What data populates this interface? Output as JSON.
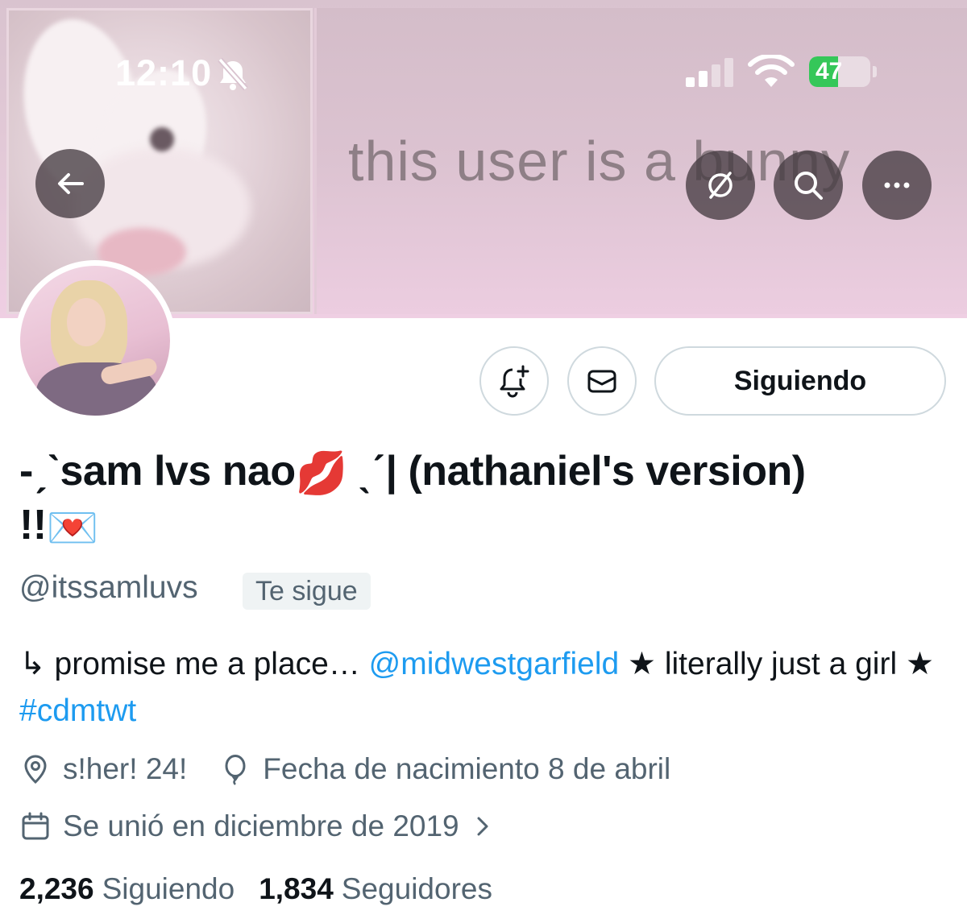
{
  "status_bar": {
    "time": "12:10",
    "battery_label": "47",
    "battery_level": 0.47,
    "battery_color": "#35c759"
  },
  "banner": {
    "text": "this user is a bunny"
  },
  "nav": {
    "back_icon": "arrow-left-icon",
    "grok_icon": "slash-circle-icon",
    "search_icon": "search-icon",
    "more_icon": "more-icon"
  },
  "actions": {
    "notify_icon": "bell-plus-icon",
    "message_icon": "envelope-icon",
    "follow_label": "Siguiendo"
  },
  "profile": {
    "name_part1": "-ˏˋsam lvs nao",
    "name_emoji1": "💋",
    "name_part2": "ˎˊ| (nathaniel's version) !!",
    "name_emoji2": "💌",
    "handle": "@itssamluvs",
    "follows_you": "Te sigue"
  },
  "bio": {
    "prefix": "↳ promise me a place… ",
    "mention": "@midwestgarfield",
    "middle": " ★ literally just a girl ★ ",
    "hashtag": "#cdmtwt"
  },
  "meta": {
    "location": "s!her! 24!",
    "birthday": "Fecha de nacimiento 8 de abril",
    "joined": "Se unió en diciembre de 2019"
  },
  "stats": {
    "following_count": "2,236",
    "following_label": "Siguiendo",
    "followers_count": "1,834",
    "followers_label": "Seguidores"
  },
  "colors": {
    "link": "#1d9bf0",
    "secondary_text": "#536471",
    "primary_text": "#0f1419"
  }
}
